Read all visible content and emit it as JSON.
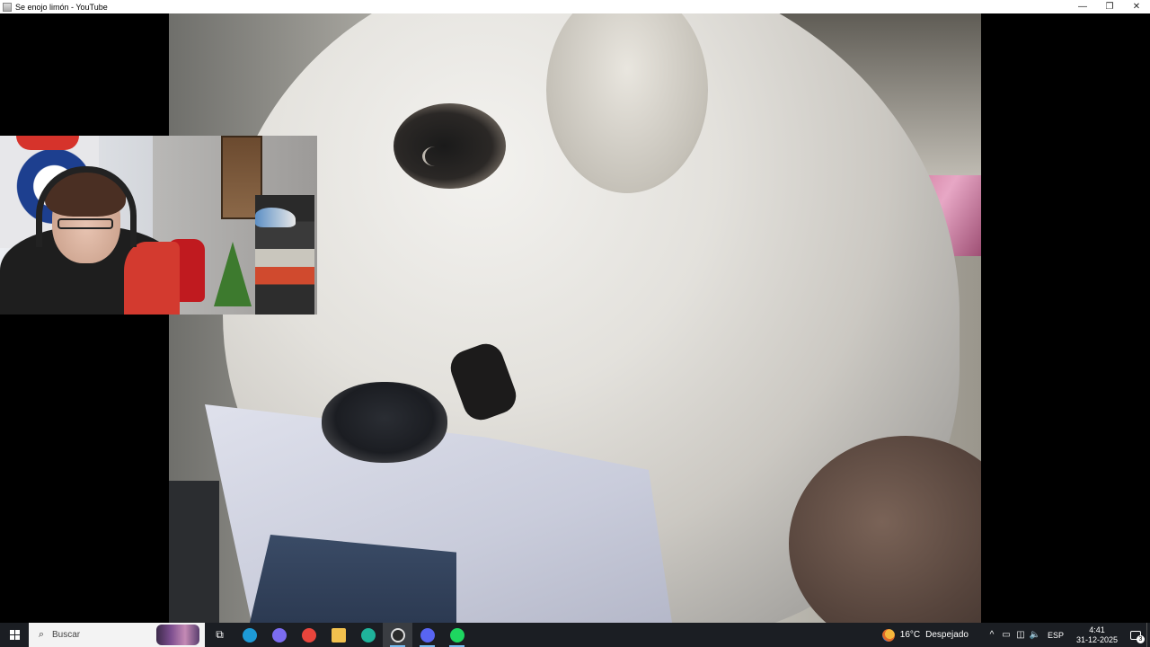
{
  "window": {
    "title": "Se enojo limón - YouTube",
    "icon": "app-window-icon",
    "controls": {
      "minimize": "—",
      "restore": "❐",
      "close": "✕"
    }
  },
  "video": {
    "content": "dog-closeup",
    "webcam_overlay": "streamer-webcam"
  },
  "taskbar": {
    "start_icon": "windows-start-icon",
    "search_placeholder": "Buscar",
    "search_icon": "⌕",
    "pinned": [
      {
        "name": "task-view-icon",
        "glyph": "⧉",
        "active": false
      },
      {
        "name": "edge-icon",
        "color": "#1d9ad6",
        "active": false
      },
      {
        "name": "copilot-icon",
        "color": "#7b6cf0",
        "active": false
      },
      {
        "name": "chrome-icon",
        "color": "#e8453c",
        "active": false
      },
      {
        "name": "file-explorer-icon",
        "color": "#f2c14e",
        "active": false
      },
      {
        "name": "app-teal-icon",
        "color": "#1fb39b",
        "active": false
      },
      {
        "name": "obs-icon",
        "color": "#2a2a2a",
        "active": true
      },
      {
        "name": "discord-icon",
        "color": "#5865f2",
        "active": true
      },
      {
        "name": "spotify-icon",
        "color": "#1ed760",
        "active": true
      }
    ],
    "weather": {
      "temperature": "16°C",
      "condition": "Despejado",
      "icon": "weather-icon"
    },
    "tray": {
      "chevron": "^",
      "icons": [
        "battery-icon",
        "network-icon",
        "volume-icon"
      ],
      "language": "ESP",
      "time": "4:41",
      "date": "31-12-2025",
      "notification_count": "3"
    }
  }
}
